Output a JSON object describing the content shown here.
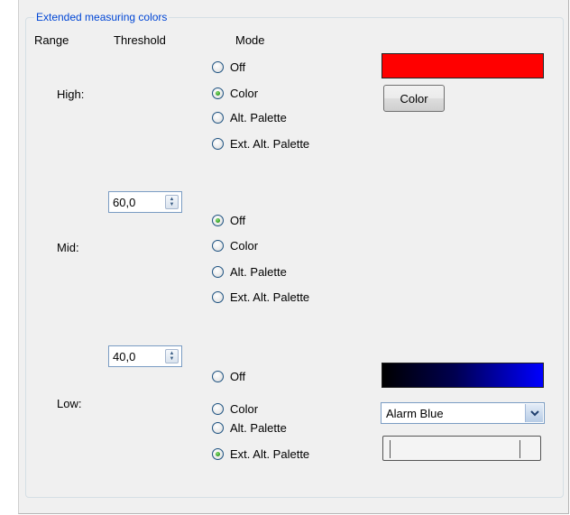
{
  "group_title": "Extended measuring colors",
  "headers": {
    "range": "Range",
    "threshold": "Threshold",
    "mode": "Mode"
  },
  "levels": {
    "high": {
      "label": "High:",
      "modes": [
        "Off",
        "Color",
        "Alt. Palette",
        "Ext. Alt. Palette"
      ],
      "selected": "Color",
      "color_swatch": "#ff0000",
      "color_button_label": "Color"
    },
    "mid": {
      "label": "Mid:",
      "threshold": "60,0",
      "modes": [
        "Off",
        "Color",
        "Alt. Palette",
        "Ext. Alt. Palette"
      ],
      "selected": "Off"
    },
    "low": {
      "label": "Low:",
      "threshold": "40,0",
      "modes": [
        "Off",
        "Color",
        "Alt. Palette",
        "Ext. Alt. Palette"
      ],
      "selected": "Ext. Alt. Palette",
      "gradient_colors": [
        "#000000",
        "#000050",
        "#0000ff"
      ],
      "palette_select": "Alarm Blue"
    }
  },
  "colors": {
    "title": "#0046d5",
    "radio_selected": "#2c9a1e"
  }
}
